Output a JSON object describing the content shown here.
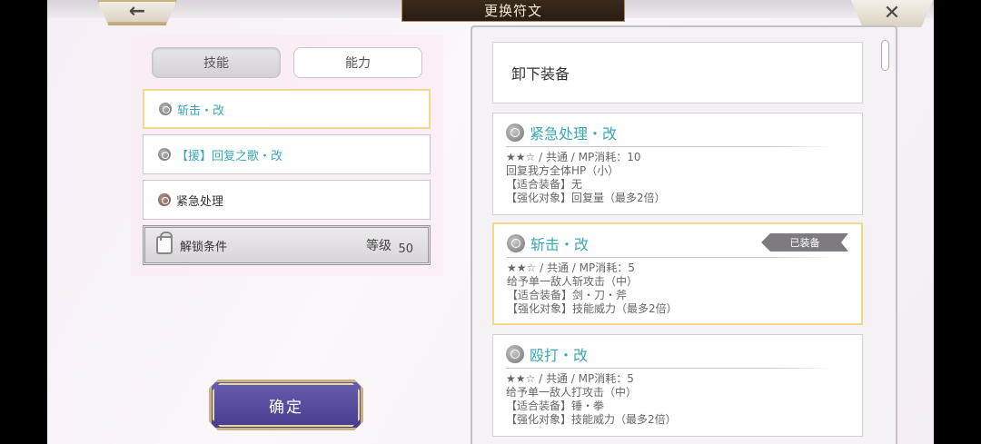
{
  "header": {
    "title": "更换符文",
    "back_glyph": "←",
    "close_glyph": "✕"
  },
  "tabs": [
    {
      "label": "技能"
    },
    {
      "label": "能力"
    }
  ],
  "skills": [
    {
      "label": "斩击・改"
    },
    {
      "label": "【援】回复之歌・改"
    },
    {
      "label": "紧急处理"
    }
  ],
  "lock": {
    "label": "解锁条件",
    "level_label": "等级",
    "level_value": "50"
  },
  "confirm_label": "确定",
  "unequip_label": "卸下装备",
  "runes": [
    {
      "name": "紧急处理・改",
      "lines": [
        "★★☆ / 共通 / MP消耗：10",
        "回复我方全体HP（小）",
        "【适合装备】无",
        "【强化对象】回复量（最多2倍）"
      ],
      "equipped": false
    },
    {
      "name": "斩击・改",
      "lines": [
        "★★☆ / 共通 / MP消耗：5",
        "给予单一敌人斩攻击（中）",
        "【适合装备】剑・刀・斧",
        "【强化对象】技能威力（最多2倍）"
      ],
      "equipped": true,
      "badge": "已装备"
    },
    {
      "name": "殴打・改",
      "lines": [
        "★★☆ / 共通 / MP消耗：5",
        "给予单一敌人打攻击（中）",
        "【适合装备】锤・拳",
        "【强化对象】技能威力（最多2倍）"
      ],
      "equipped": false
    }
  ]
}
